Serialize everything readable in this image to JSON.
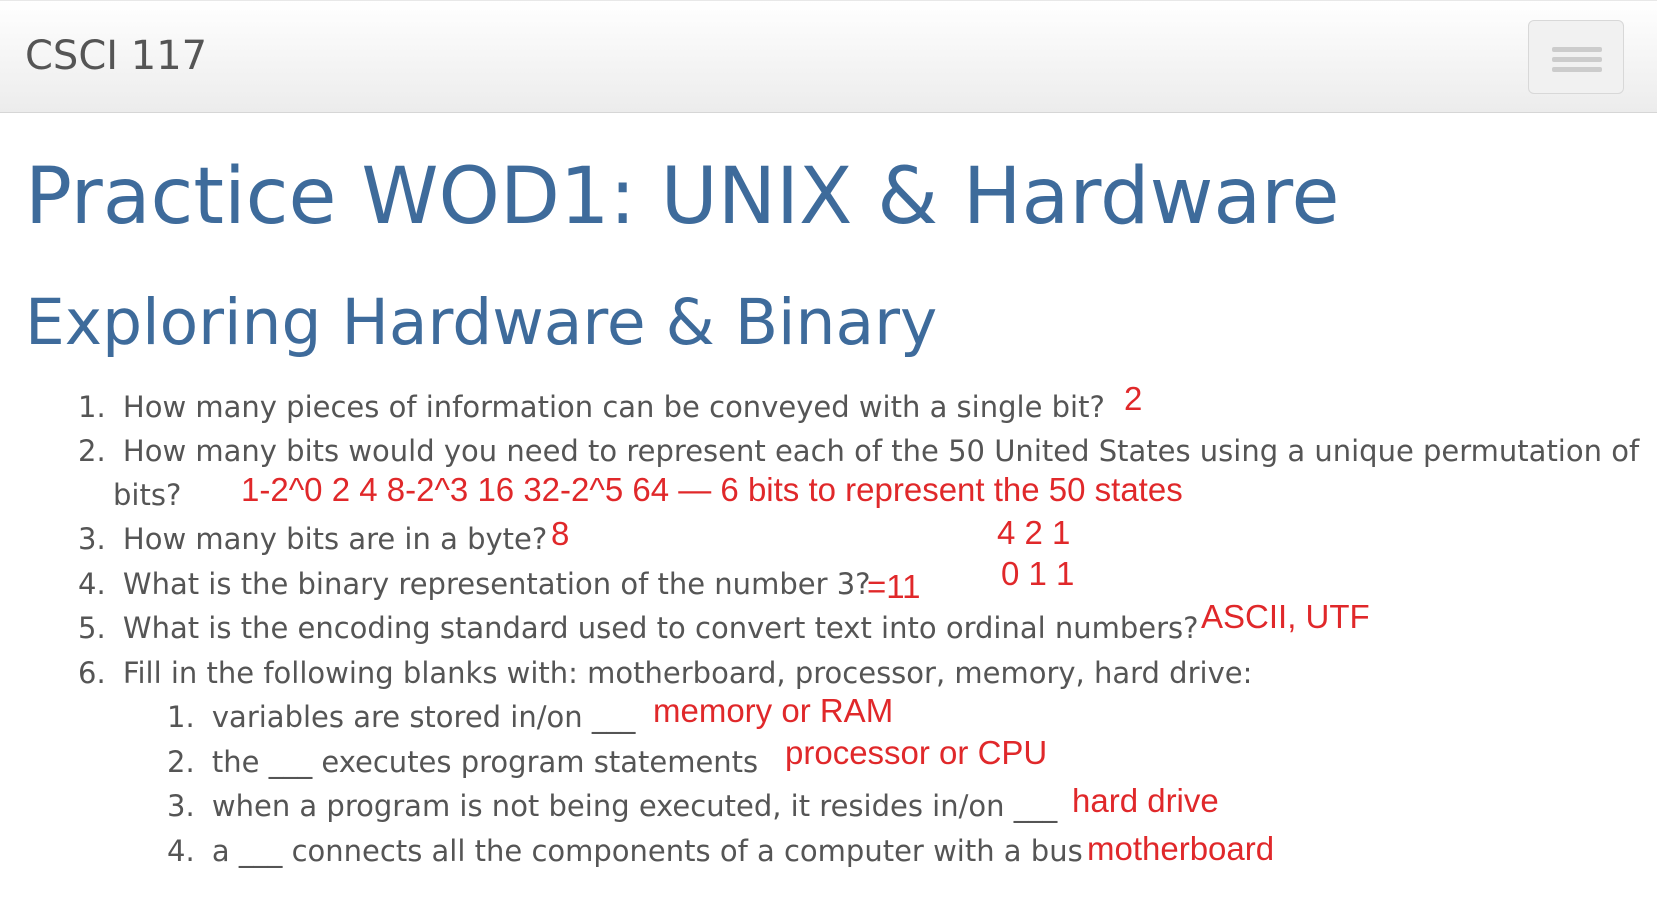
{
  "navbar": {
    "brand": "CSCI 117",
    "menu_button_label": "menu"
  },
  "page": {
    "title": "Practice WOD1: UNIX & Hardware",
    "section_title": "Exploring Hardware & Binary"
  },
  "questions": [
    {
      "number": "1.",
      "text": "How many pieces of information can be conveyed with a single bit?"
    },
    {
      "number": "2.",
      "text": "How many bits would you need to represent each of the 50 United States using a unique permutation of",
      "text_cont": "bits?"
    },
    {
      "number": "3.",
      "text": "How many bits are in a byte?"
    },
    {
      "number": "4.",
      "text": "What is the binary representation of the number 3?"
    },
    {
      "number": "5.",
      "text": "What is the encoding standard used to convert text into ordinal numbers?"
    },
    {
      "number": "6.",
      "text": "Fill in the following blanks with: motherboard, processor, memory, hard drive:"
    }
  ],
  "subquestions": [
    {
      "number": "1.",
      "text": "variables are stored in/on ___"
    },
    {
      "number": "2.",
      "text": "the ___ executes program statements"
    },
    {
      "number": "3.",
      "text": "when a program is not being executed, it resides in/on ___"
    },
    {
      "number": "4.",
      "text": "a ___ connects all the components of a computer with a bus"
    }
  ],
  "annotations": {
    "q1": "2",
    "q2": "1-2^0 2 4 8-2^3 16 32-2^5 64 — 6 bits to represent the 50 states",
    "q3": "8",
    "place_values": "4 2 1",
    "bits": "0 1 1",
    "q4": "=11",
    "q5": "ASCII, UTF",
    "s1": "memory or RAM",
    "s2": "processor or CPU",
    "s3": "hard drive",
    "s4": "motherboard"
  },
  "colors": {
    "heading": "#3e6b9b",
    "body_text": "#555555",
    "annotation": "#e0282a"
  }
}
